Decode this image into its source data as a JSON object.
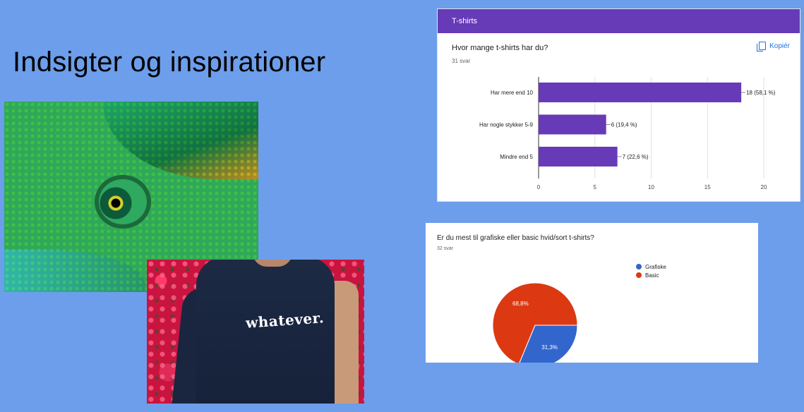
{
  "slide": {
    "title": "Indsigter og inspirationer"
  },
  "photos": {
    "shirt_text": "whatever."
  },
  "bar_card": {
    "header": "T-shirts",
    "question": "Hvor mange t-shirts har du?",
    "count": "31 svar",
    "copy_label": "Kopiér",
    "accent": "#673ab7"
  },
  "pie_card": {
    "question": "Er du mest til grafiske eller basic hvid/sort t-shirts?",
    "count": "32 svar"
  },
  "chart_data": [
    {
      "type": "bar",
      "orientation": "horizontal",
      "categories": [
        "Har mere end 10",
        "Har nogle stykker 5-9",
        "Mindre end 5"
      ],
      "values": [
        18,
        6,
        7
      ],
      "data_labels": [
        "18 (58,1 %)",
        "6 (19,4 %)",
        "7 (22,6 %)"
      ],
      "xlim": [
        0,
        20
      ],
      "xticks": [
        0,
        5,
        10,
        15,
        20
      ],
      "color": "#673ab7",
      "grid": true
    },
    {
      "type": "pie",
      "labels": [
        "Grafiske",
        "Basic"
      ],
      "values": [
        31.3,
        68.8
      ],
      "data_labels": [
        "31,3%",
        "68,8%"
      ],
      "colors": [
        "#3366cc",
        "#dc3912"
      ],
      "legend": "right"
    }
  ]
}
